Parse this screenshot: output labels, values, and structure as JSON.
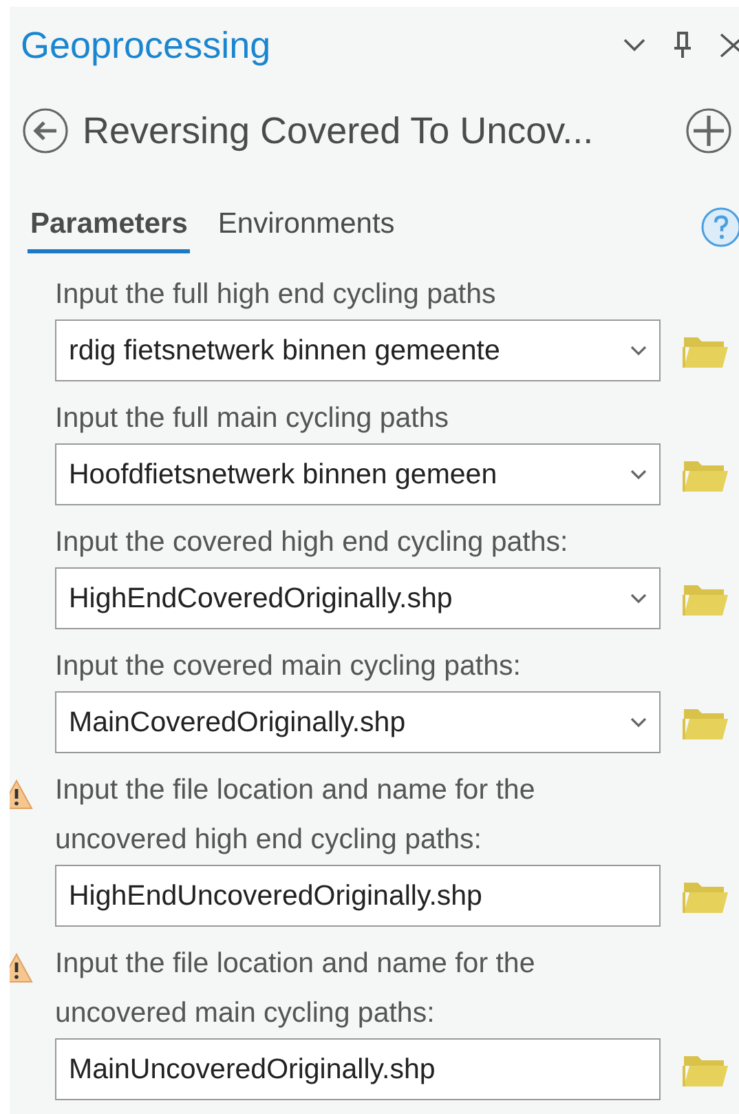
{
  "pane": {
    "title": "Geoprocessing"
  },
  "tool": {
    "title": "Reversing Covered To Uncov..."
  },
  "tabs": [
    {
      "label": "Parameters",
      "selected": true
    },
    {
      "label": "Environments",
      "selected": false
    }
  ],
  "parameters": [
    {
      "label": "Input the full high end cycling paths",
      "kind": "dropdown",
      "value": "rdig fietsnetwerk binnen gemeente",
      "warning": false
    },
    {
      "label": "Input the full main cycling paths",
      "kind": "dropdown",
      "value": "Hoofdfietsnetwerk binnen gemeen",
      "warning": false
    },
    {
      "label": "Input the covered high end cycling paths:",
      "kind": "dropdown",
      "value": "HighEndCoveredOriginally.shp",
      "warning": false
    },
    {
      "label": "Input the covered main cycling paths:",
      "kind": "dropdown",
      "value": "MainCoveredOriginally.shp",
      "warning": false
    },
    {
      "label": "Input the file location and name for the uncovered high end cycling paths:",
      "kind": "text",
      "value": "HighEndUncoveredOriginally.shp",
      "warning": true
    },
    {
      "label": "Input the file location and name for the uncovered main cycling paths:",
      "kind": "text",
      "value": "MainUncoveredOriginally.shp",
      "warning": true
    }
  ]
}
